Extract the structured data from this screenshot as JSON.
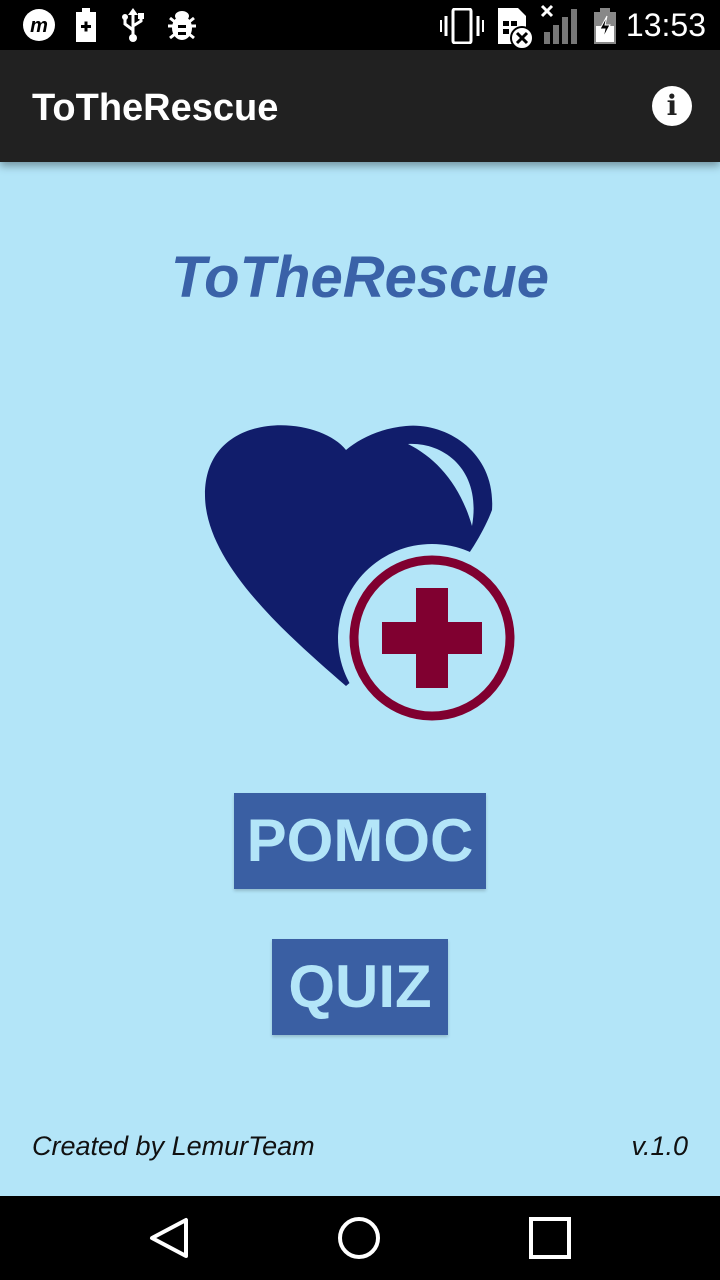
{
  "status_bar": {
    "time": "13:53",
    "icons": [
      "m-notification-icon",
      "battery-saver-icon",
      "usb-icon",
      "debug-bug-icon",
      "vibrate-icon",
      "sim-error-icon",
      "signal-no-service-icon",
      "battery-charging-icon"
    ]
  },
  "app_bar": {
    "title": "ToTheRescue",
    "info_icon": "info-icon"
  },
  "main": {
    "headline": "ToTheRescue",
    "logo_icon": "heart-medical-cross-icon",
    "buttons": {
      "help_label": "POMOC",
      "quiz_label": "QUIZ"
    },
    "footer": {
      "credit": "Created by LemurTeam",
      "version": "v.1.0"
    }
  },
  "nav_bar": {
    "icons": [
      "back-icon",
      "home-icon",
      "recents-icon"
    ]
  },
  "colors": {
    "background": "#b3e5f8",
    "app_bar": "#212121",
    "accent_blue": "#3a62a8",
    "button": "#3a5fa3",
    "heart": "#111d6b",
    "cross": "#800030"
  }
}
